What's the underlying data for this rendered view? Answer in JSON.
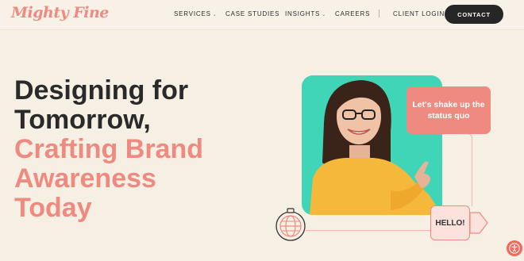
{
  "nav": {
    "logo": "Mighty Fine",
    "items": [
      {
        "label": "SERVICES",
        "has_dropdown": true
      },
      {
        "label": "CASE STUDIES",
        "has_dropdown": false
      },
      {
        "label": "INSIGHTS",
        "has_dropdown": true
      },
      {
        "label": "CAREERS",
        "has_dropdown": false
      }
    ],
    "client_login": "CLIENT LOGIN",
    "contact": "CONTACT"
  },
  "hero": {
    "line1": "Designing for",
    "line2": "Tomorrow,",
    "line3": "Crafting Brand",
    "line4": "Awareness",
    "line5": "Today",
    "speech_bubble": "Let's shake up the status quo",
    "hello_label": "HELLO!"
  },
  "colors": {
    "background": "#f6efe3",
    "accent_pink": "#ee8a80",
    "teal": "#41d5b8",
    "dark": "#2a2a2a",
    "sweater": "#f4b83a"
  },
  "icons": {
    "globe": "globe-icon",
    "accessibility": "accessibility-icon",
    "arrow": "arrow-right-icon"
  }
}
